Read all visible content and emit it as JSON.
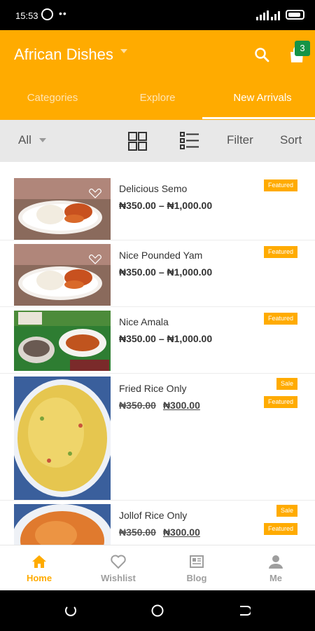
{
  "status_bar": {
    "time": "15:53",
    "more": "••"
  },
  "app_bar": {
    "title": "African Dishes",
    "cart_count": "3",
    "tabs": [
      {
        "label": "Categories"
      },
      {
        "label": "Explore"
      },
      {
        "label": "New Arrivals"
      }
    ],
    "active_tab": "New Arrivals"
  },
  "toolbar": {
    "category": "All",
    "filter_label": "Filter",
    "sort_label": "Sort"
  },
  "products": [
    {
      "name": "Delicious Semo",
      "price": "₦350.00 – ₦1,000.00",
      "badges": [
        "Featured"
      ]
    },
    {
      "name": "Nice Pounded Yam",
      "price": "₦350.00 – ₦1,000.00",
      "badges": [
        "Featured"
      ]
    },
    {
      "name": "Nice Amala",
      "price": "₦350.00 – ₦1,000.00",
      "badges": [
        "Featured"
      ]
    },
    {
      "name": "Fried Rice Only",
      "old_price": "₦350.00",
      "new_price": "₦300.00",
      "badges": [
        "Sale",
        "Featured"
      ]
    },
    {
      "name": "Jollof Rice Only",
      "old_price": "₦350.00",
      "new_price": "₦300.00",
      "badges": [
        "Sale",
        "Featured"
      ]
    }
  ],
  "bottom_nav": [
    {
      "label": "Home",
      "icon": "home-icon",
      "active": true
    },
    {
      "label": "Wishlist",
      "icon": "heart-icon",
      "active": false
    },
    {
      "label": "Blog",
      "icon": "newspaper-icon",
      "active": false
    },
    {
      "label": "Me",
      "icon": "person-icon",
      "active": false
    }
  ],
  "colors": {
    "accent": "#ffab00",
    "badge_green": "#159447"
  }
}
